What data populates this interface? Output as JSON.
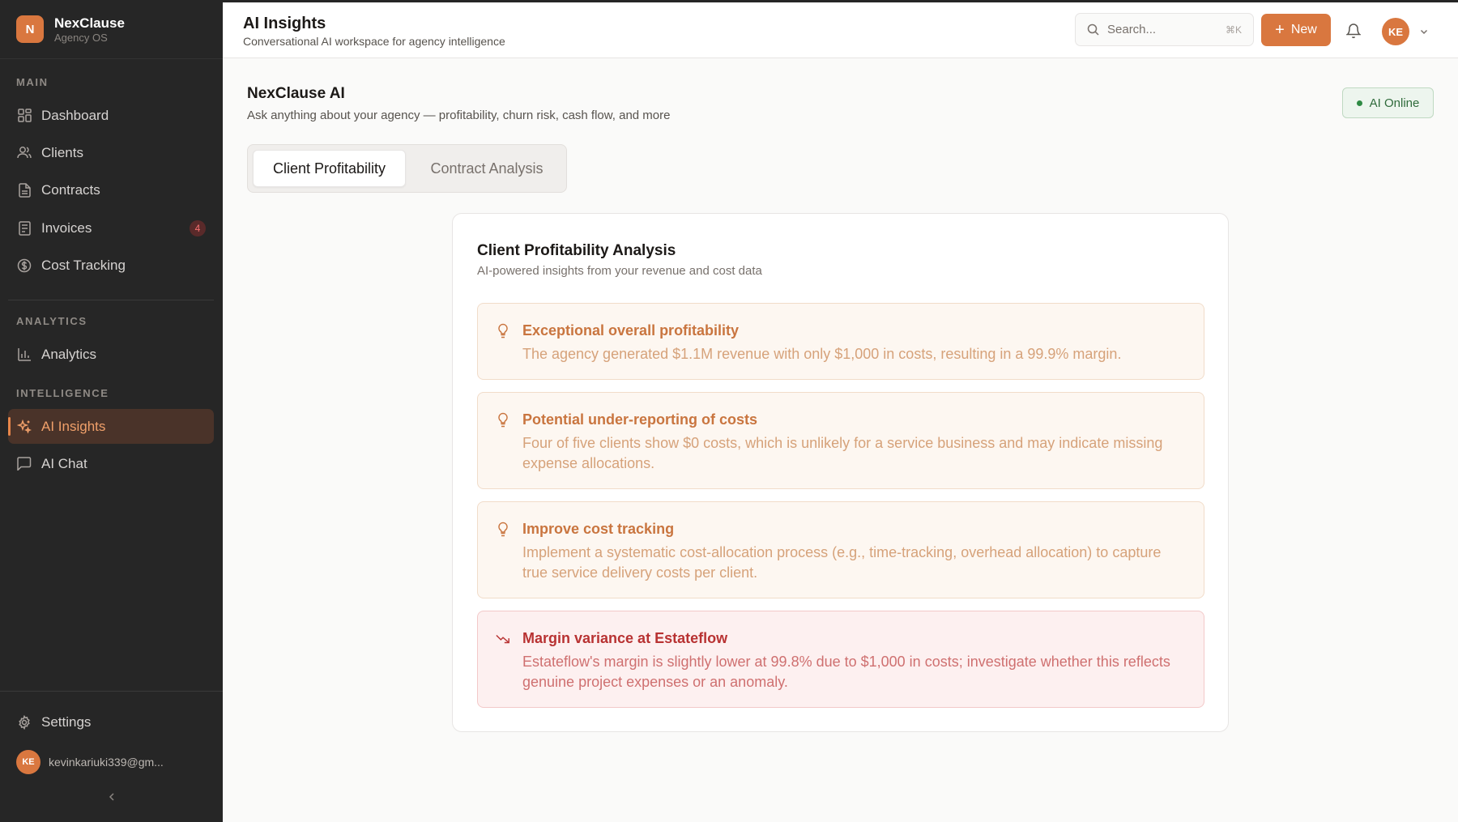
{
  "sidebar": {
    "brand": {
      "initial": "N",
      "name": "NexClause",
      "subtitle": "Agency OS"
    },
    "sections": {
      "main": "MAIN",
      "analytics": "ANALYTICS",
      "intelligence": "INTELLIGENCE"
    },
    "items": {
      "dashboard": "Dashboard",
      "clients": "Clients",
      "contracts": "Contracts",
      "invoices": "Invoices",
      "invoices_badge": "4",
      "cost_tracking": "Cost Tracking",
      "analytics": "Analytics",
      "ai_insights": "AI Insights",
      "ai_chat": "AI Chat",
      "settings": "Settings"
    },
    "user": {
      "initials": "KE",
      "email": "kevinkariuki339@gm..."
    },
    "active_item": "AI Insights",
    "accent": "#d9773f"
  },
  "header": {
    "title": "AI Insights",
    "subtitle": "Conversational AI workspace for agency intelligence",
    "search": {
      "placeholder": "Search...",
      "shortcut": "⌘K"
    },
    "new_button": "New",
    "avatar_initials": "KE"
  },
  "main": {
    "title": "NexClause AI",
    "subtitle": "Ask anything about your agency — profitability, churn risk, cash flow, and more",
    "status": "AI Online",
    "tabs": [
      {
        "label": "Client Profitability",
        "active": true
      },
      {
        "label": "Contract Analysis",
        "active": false
      }
    ],
    "panel": {
      "title": "Client Profitability Analysis",
      "subtitle": "AI-powered insights from your revenue and cost data",
      "insights": [
        {
          "icon": "lightbulb-icon",
          "title": "Exceptional overall profitability",
          "body": "The agency generated $1.1M revenue with only $1,000 in costs, resulting in a 99.9% margin.",
          "tone": "info"
        },
        {
          "icon": "lightbulb-icon",
          "title": "Potential under-reporting of costs",
          "body": "Four of five clients show $0 costs, which is unlikely for a service business and may indicate missing expense allocations.",
          "tone": "info"
        },
        {
          "icon": "lightbulb-icon",
          "title": "Improve cost tracking",
          "body": "Implement a systematic cost-allocation process (e.g., time-tracking, overhead allocation) to capture true service delivery costs per client.",
          "tone": "info"
        },
        {
          "icon": "trending-down-icon",
          "title": "Margin variance at Estateflow",
          "body": "Estateflow's margin is slightly lower at 99.8% due to $1,000 in costs; investigate whether this reflects genuine project expenses or an anomaly.",
          "tone": "warning"
        }
      ]
    }
  }
}
